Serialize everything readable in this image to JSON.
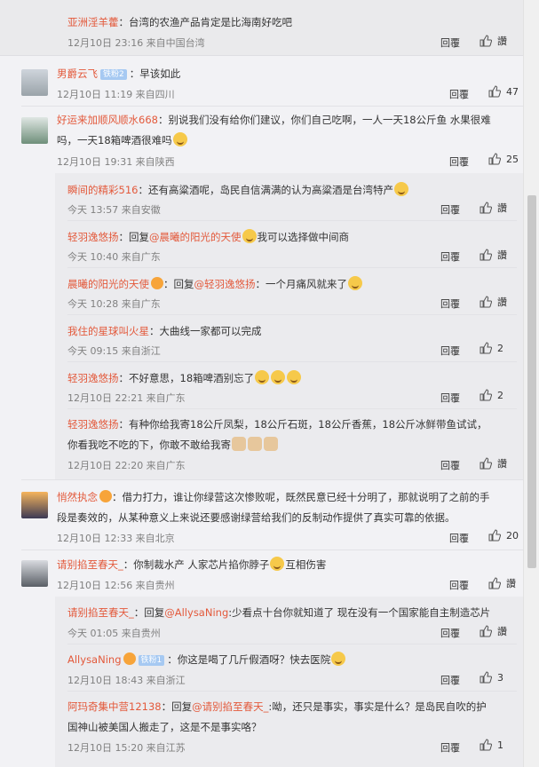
{
  "top": {
    "name": "亚洲淫羊藿",
    "text": "：台湾的农渔产品肯定是比海南好吃吧",
    "meta": "12月10日 23:16 来自中国台湾",
    "reply": "回覆",
    "like": "讚"
  },
  "c1": {
    "name": "男爵云飞",
    "badge": "铁粉2",
    "text": "：早该如此",
    "meta": "12月10日 11:19 来自四川",
    "reply": "回覆",
    "likes": "47"
  },
  "c2": {
    "name": "好运来加顺风顺水668",
    "text1": "：别说我们没有给你们建议，你们自己吃啊，一人一天18公斤鱼 水果很难",
    "text2": "吗，一天18箱啤酒很难吗",
    "meta": "12月10日 19:31 来自陕西",
    "reply": "回覆",
    "likes": "25",
    "subs": [
      {
        "name": "瞬间的精彩516",
        "text": "：还有高粱酒呢，岛民自信满满的认为高粱酒是台湾特产",
        "meta": "今天 13:57 来自安徽",
        "reply": "回覆",
        "like": "讚"
      },
      {
        "name": "轻羽逸悠扬",
        "pre": "：回复",
        "at": "@晨曦的阳光的天使",
        "text": "我可以选择做中间商",
        "meta": "今天 10:40 来自广东",
        "reply": "回覆",
        "like": "讚"
      },
      {
        "name": "晨曦的阳光的天使",
        "pre": "：回复",
        "at": "@轻羽逸悠扬",
        "text": "：一个月痛风就来了",
        "meta": "今天 10:28 来自广东",
        "reply": "回覆",
        "like": "讚"
      },
      {
        "name": "我住的星球叫火星",
        "text": "：大曲线一家都可以完成",
        "meta": "今天 09:15 来自浙江",
        "reply": "回覆",
        "likes": "2"
      },
      {
        "name": "轻羽逸悠扬",
        "text": "：不好意思，18箱啤酒别忘了",
        "meta": "12月10日 22:21 来自广东",
        "reply": "回覆",
        "likes": "2"
      },
      {
        "name": "轻羽逸悠扬",
        "text1": "：有种你给我寄18公斤凤梨，18公斤石斑，18公斤香蕉，18公斤冰鲜带鱼试试，",
        "text2": "你看我吃不吃的下，你敢不敢给我寄",
        "meta": "12月10日 22:20 来自广东",
        "reply": "回覆",
        "like": "讚"
      }
    ]
  },
  "c3": {
    "name": "悄然执念",
    "text1": "：借力打力，谁让你绿营这次惨败呢，既然民意已经十分明了，那就说明了之前的手",
    "text2": "段是奏效的，从某种意义上来说还要感谢绿营给我们的反制动作提供了真实可靠的依据。",
    "meta": "12月10日 12:33 来自北京",
    "reply": "回覆",
    "likes": "20"
  },
  "c4": {
    "name": "请别掐至春天_",
    "text": "：你制裁水产 人家芯片掐你脖子",
    "text_end": "互相伤害",
    "meta": "12月10日 12:56 来自贵州",
    "reply": "回覆",
    "like": "讚",
    "subs": [
      {
        "name": "请别掐至春天_",
        "pre": "：回复",
        "at": "@AllysaNing",
        "text": ":少看点十台你就知道了 现在没有一个国家能自主制造芯片",
        "meta": "今天 01:05 来自贵州",
        "reply": "回覆",
        "like": "讚"
      },
      {
        "name": "AllysaNing",
        "badge": "铁粉1",
        "text": "：你这是喝了几斤假酒呀？快去医院",
        "meta": "12月10日 18:43 来自浙江",
        "reply": "回覆",
        "likes": "3"
      },
      {
        "name": "阿玛奇集中营12138",
        "pre": "：回复",
        "at": "@请别掐至春天_",
        "text1": ":呦，还只是事实，事实是什么？是岛民自吹的护",
        "text2": "国神山被美国人搬走了，这是不是事实咯？",
        "meta": "12月10日 15:20 来自江苏",
        "reply": "回覆",
        "likes": "1"
      }
    ]
  }
}
